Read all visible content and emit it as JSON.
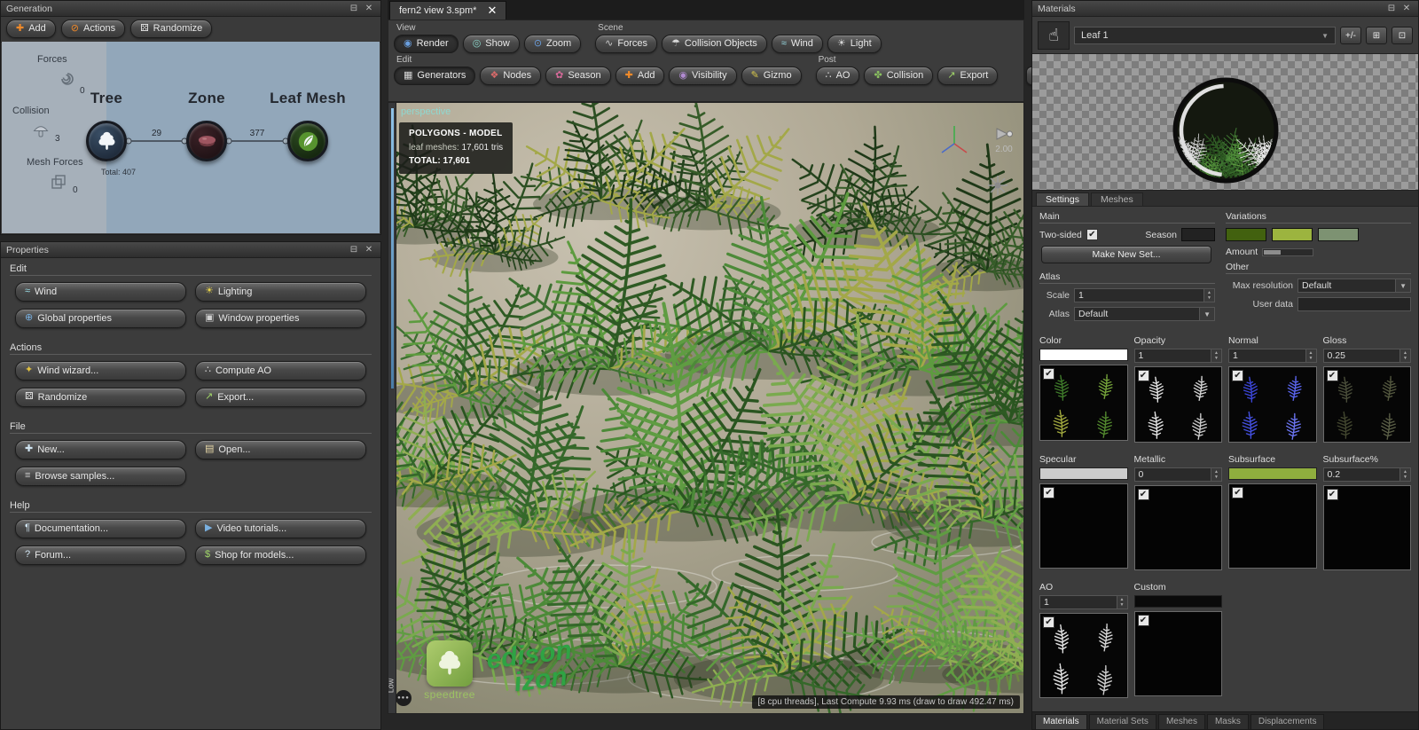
{
  "colors": {
    "accent_orange": "#f08a2a",
    "graph_bg": "#92a7ba",
    "leaf_green": "#57942f",
    "zone_red": "#9e5560",
    "normal_blue": "#3c46d8",
    "watermark_green": "#2fa344",
    "perspective_teal": "#8fd8d0"
  },
  "generation": {
    "title": "Generation",
    "toolbar": [
      {
        "label": "Add",
        "icon": "add-icon"
      },
      {
        "label": "Actions",
        "icon": "actions-icon"
      },
      {
        "label": "Randomize",
        "icon": "dice-icon"
      }
    ],
    "graph": {
      "side_items": [
        {
          "label": "Forces",
          "count": "0",
          "icon": "force-icon"
        },
        {
          "label": "Collision",
          "count": "3",
          "icon": "mushroom-icon"
        },
        {
          "label": "Mesh Forces",
          "count": "0",
          "icon": "mesh-force-icon"
        }
      ],
      "nodes": [
        {
          "label": "Tree",
          "icon": "tree-icon"
        },
        {
          "label": "Zone",
          "icon": "zone-icon"
        },
        {
          "label": "Leaf Mesh",
          "icon": "leaf-icon"
        }
      ],
      "edges": [
        "29",
        "377"
      ],
      "total": "Total: 407"
    }
  },
  "properties": {
    "title": "Properties",
    "groups": [
      {
        "label": "Edit",
        "buttons": [
          {
            "label": "Wind",
            "icon": "wind-icon"
          },
          {
            "label": "Lighting",
            "icon": "lighting-icon"
          },
          {
            "label": "Global properties",
            "icon": "globe-icon"
          },
          {
            "label": "Window properties",
            "icon": "window-icon"
          }
        ]
      },
      {
        "label": "Actions",
        "buttons": [
          {
            "label": "Wind wizard...",
            "icon": "wizard-icon"
          },
          {
            "label": "Compute AO",
            "icon": "ao-icon"
          },
          {
            "label": "Randomize",
            "icon": "dice-icon"
          },
          {
            "label": "Export...",
            "icon": "export-icon"
          }
        ]
      },
      {
        "label": "File",
        "buttons": [
          {
            "label": "New...",
            "icon": "new-icon"
          },
          {
            "label": "Open...",
            "icon": "open-icon"
          },
          {
            "label": "Browse samples...",
            "icon": "browse-icon"
          }
        ]
      },
      {
        "label": "Help",
        "buttons": [
          {
            "label": "Documentation...",
            "icon": "docs-icon"
          },
          {
            "label": "Video tutorials...",
            "icon": "video-icon"
          },
          {
            "label": "Forum...",
            "icon": "forum-icon"
          },
          {
            "label": "Shop for models...",
            "icon": "shop-icon"
          }
        ]
      }
    ]
  },
  "workspace": {
    "tab": "fern2 view 3.spm*",
    "toolbar_rows": [
      [
        {
          "group": "View",
          "buttons": [
            {
              "label": "Render",
              "icon": "render-icon",
              "active": true
            },
            {
              "label": "Show",
              "icon": "show-icon"
            },
            {
              "label": "Zoom",
              "icon": "zoom-icon"
            }
          ]
        },
        {
          "group": "Scene",
          "buttons": [
            {
              "label": "Forces",
              "icon": "force-icon"
            },
            {
              "label": "Collision Objects",
              "icon": "mushroom-icon"
            },
            {
              "label": "Wind",
              "icon": "wind-icon"
            },
            {
              "label": "Light",
              "icon": "light-icon"
            }
          ]
        }
      ],
      [
        {
          "group": "Edit",
          "buttons": [
            {
              "label": "Generators",
              "icon": "generators-icon",
              "active": true
            },
            {
              "label": "Nodes",
              "icon": "nodes-icon"
            },
            {
              "label": "Season",
              "icon": "season-icon"
            },
            {
              "label": "Add",
              "icon": "add-icon"
            },
            {
              "label": "Visibility",
              "icon": "visibility-icon"
            },
            {
              "label": "Gizmo",
              "icon": "gizmo-icon"
            }
          ]
        },
        {
          "group": "Post",
          "buttons": [
            {
              "label": "AO",
              "icon": "ao-icon"
            },
            {
              "label": "Collision",
              "icon": "collision-icon"
            },
            {
              "label": "Export",
              "icon": "export-icon"
            }
          ]
        }
      ]
    ],
    "viewport": {
      "mode": "perspective",
      "stats_title": "POLYGONS - MODEL",
      "stats_line1_label": "leaf meshes:",
      "stats_line1_value": "17,601 tris",
      "stats_line2_label": "TOTAL:",
      "stats_line2_value": "17,601",
      "light_value": "2.00",
      "slider_label": "Low",
      "logo_text": "speedtree",
      "watermark_line1": "edison",
      "watermark_line2": "izon",
      "status": "[8 cpu threads], Last Compute 9.93 ms (draw to draw 492.47 ms)"
    }
  },
  "materials": {
    "title": "Materials",
    "selected": "Leaf 1",
    "header_buttons": [
      "+/-"
    ],
    "tabs": [
      {
        "label": "Settings",
        "active": true
      },
      {
        "label": "Meshes"
      }
    ],
    "main": {
      "label": "Main",
      "two_sided": "Two-sided",
      "season": "Season"
    },
    "variations": {
      "label": "Variations",
      "swatches": [
        "#42610f",
        "#9cb43f",
        "#7d9272"
      ],
      "amount": "Amount"
    },
    "make_new_set": "Make New Set...",
    "atlas": {
      "label": "Atlas",
      "scale_label": "Scale",
      "scale_value": "1",
      "atlas_label": "Atlas",
      "atlas_value": "Default"
    },
    "other": {
      "label": "Other",
      "max_res_label": "Max resolution",
      "max_res_value": "Default",
      "user_data_label": "User data"
    },
    "slots": [
      {
        "label": "Color",
        "control": "swatch",
        "swatch": "#ffffff",
        "thumb": "color",
        "checked": true
      },
      {
        "label": "Opacity",
        "control": "spin",
        "value": "1",
        "thumb": "white",
        "checked": true
      },
      {
        "label": "Normal",
        "control": "spin",
        "value": "1",
        "thumb": "blue",
        "checked": true
      },
      {
        "label": "Gloss",
        "control": "spin",
        "value": "0.25",
        "thumb": "dark",
        "checked": true
      },
      {
        "label": "Specular",
        "control": "swatch",
        "swatch": "#cccccc",
        "thumb": "none",
        "checked": true
      },
      {
        "label": "Metallic",
        "control": "spin",
        "value": "0",
        "thumb": "none",
        "checked": true
      },
      {
        "label": "Subsurface",
        "control": "swatch",
        "swatch": "#8fae3e",
        "thumb": "none",
        "checked": true
      },
      {
        "label": "Subsurface%",
        "control": "spin",
        "value": "0.2",
        "thumb": "none",
        "checked": true
      },
      {
        "label": "AO",
        "control": "spin",
        "value": "1",
        "thumb": "white",
        "checked": true
      },
      {
        "label": "Custom",
        "control": "swatch",
        "swatch": "#0a0a0a",
        "thumb": "none",
        "checked": true
      }
    ],
    "bottom_tabs": [
      {
        "label": "Materials",
        "active": true
      },
      {
        "label": "Material Sets"
      },
      {
        "label": "Meshes"
      },
      {
        "label": "Masks"
      },
      {
        "label": "Displacements"
      }
    ]
  }
}
